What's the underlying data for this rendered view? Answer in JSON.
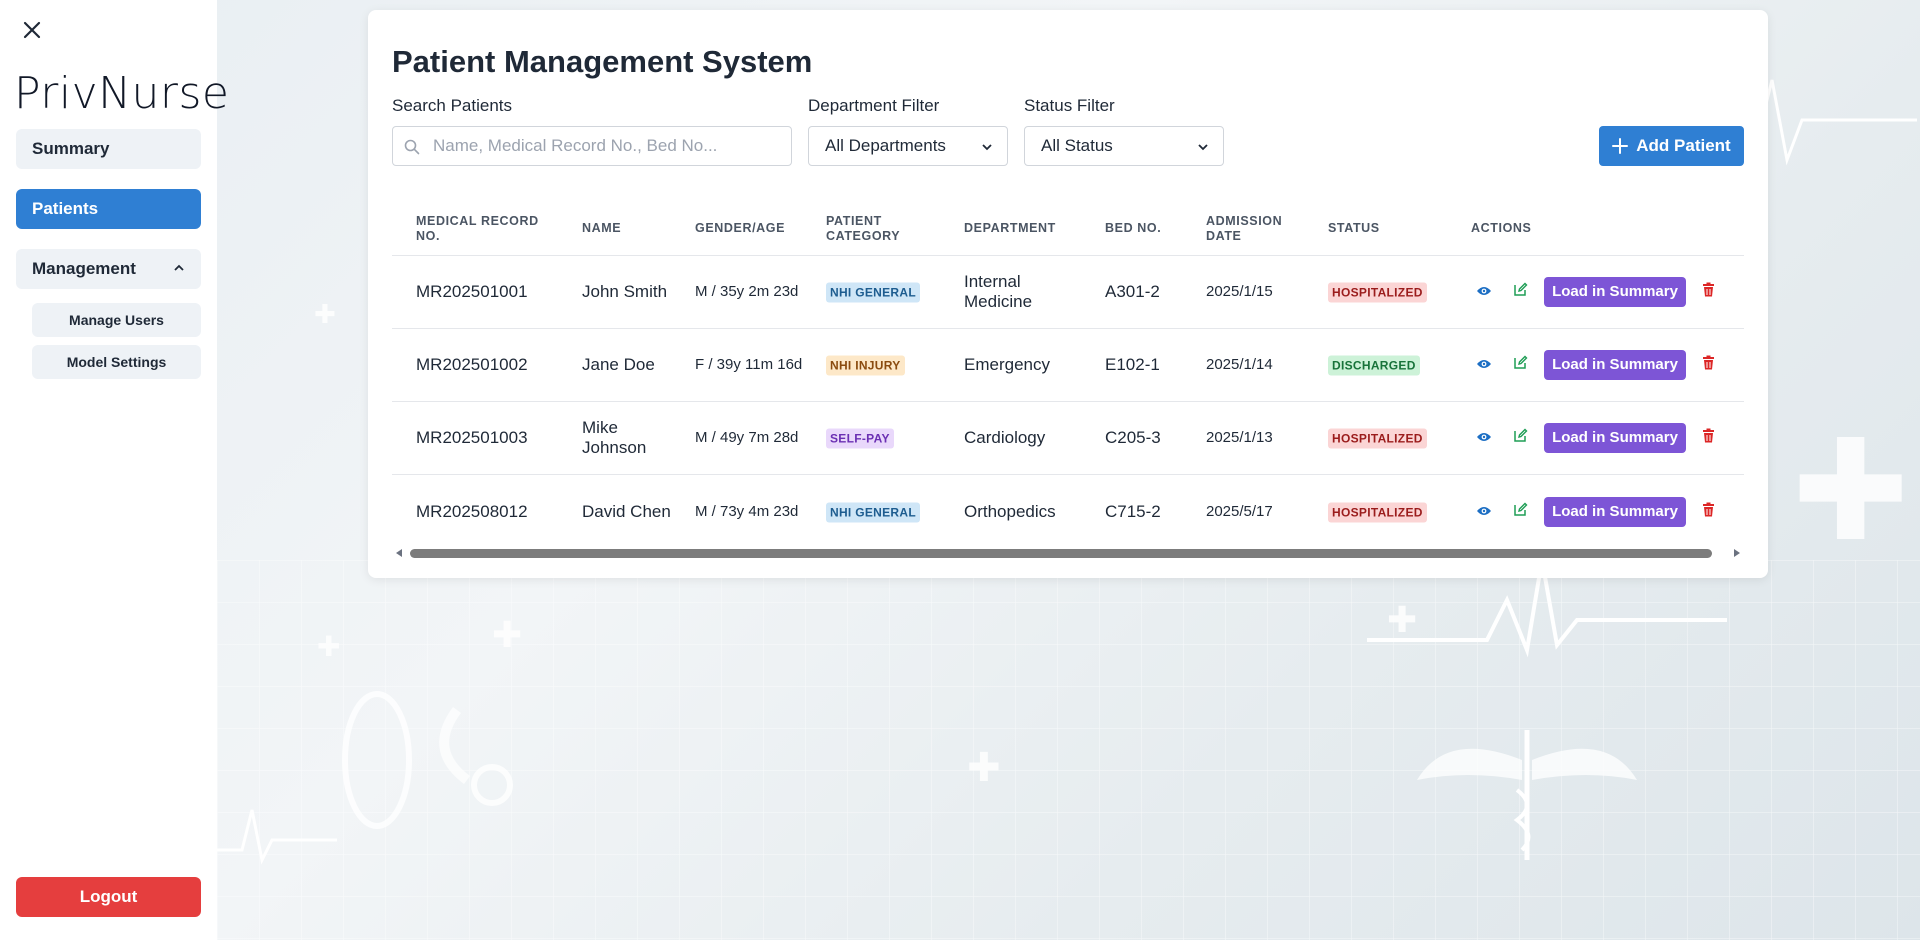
{
  "sidebar": {
    "brand": "PrivNurse",
    "summary_label": "Summary",
    "patients_label": "Patients",
    "management_label": "Management",
    "manage_users_label": "Manage Users",
    "model_settings_label": "Model Settings",
    "logout_label": "Logout"
  },
  "main": {
    "title": "Patient Management System",
    "search_label": "Search Patients",
    "search_placeholder": "Name, Medical Record No., Bed No...",
    "department_label": "Department Filter",
    "department_value": "All Departments",
    "status_label": "Status Filter",
    "status_value": "All Status",
    "add_button": "Add Patient"
  },
  "table": {
    "headers": {
      "mrn": "MEDICAL RECORD NO.",
      "name": "NAME",
      "gender_age": "GENDER/AGE",
      "category": "PATIENT CATEGORY",
      "department": "DEPARTMENT",
      "bed": "BED NO.",
      "admission": "ADMISSION DATE",
      "status": "STATUS",
      "actions": "ACTIONS"
    },
    "load_label": "Load in Summary",
    "rows": [
      {
        "mrn": "MR202501001",
        "name": "John Smith",
        "gender_age": "M / 35y 2m 23d",
        "category": "NHI GENERAL",
        "department": "Internal Medicine",
        "bed": "A301-2",
        "admission": "2025/1/15",
        "status": "HOSPITALIZED"
      },
      {
        "mrn": "MR202501002",
        "name": "Jane Doe",
        "gender_age": "F / 39y 11m 16d",
        "category": "NHI INJURY",
        "department": "Emergency",
        "bed": "E102-1",
        "admission": "2025/1/14",
        "status": "DISCHARGED"
      },
      {
        "mrn": "MR202501003",
        "name": "Mike Johnson",
        "gender_age": "M / 49y 7m 28d",
        "category": "SELF-PAY",
        "department": "Cardiology",
        "bed": "C205-3",
        "admission": "2025/1/13",
        "status": "HOSPITALIZED"
      },
      {
        "mrn": "MR202508012",
        "name": "David Chen",
        "gender_age": "M / 73y 4m 23d",
        "category": "NHI GENERAL",
        "department": "Orthopedics",
        "bed": "C715-2",
        "admission": "2025/5/17",
        "status": "HOSPITALIZED"
      }
    ]
  },
  "badge_colors": {
    "NHI GENERAL": {
      "bg": "#cfe6f7",
      "fg": "#1d5c8f"
    },
    "NHI INJURY": {
      "bg": "#fde8c8",
      "fg": "#8a4b0f"
    },
    "SELF-PAY": {
      "bg": "#e9d8fb",
      "fg": "#6b2fb3"
    },
    "HOSPITALIZED": {
      "bg": "#fbd5d5",
      "fg": "#9b1c1c"
    },
    "DISCHARGED": {
      "bg": "#cdf2d8",
      "fg": "#18733a"
    }
  },
  "colors": {
    "primary": "#2f7fd3",
    "load": "#7d55d6",
    "logout": "#e53e3e"
  },
  "icons": {
    "close": "close-icon",
    "search": "search-icon",
    "chevron": "chevron-down-icon",
    "plus": "plus-icon",
    "view": "eye-icon",
    "edit": "edit-icon",
    "delete": "trash-icon"
  }
}
